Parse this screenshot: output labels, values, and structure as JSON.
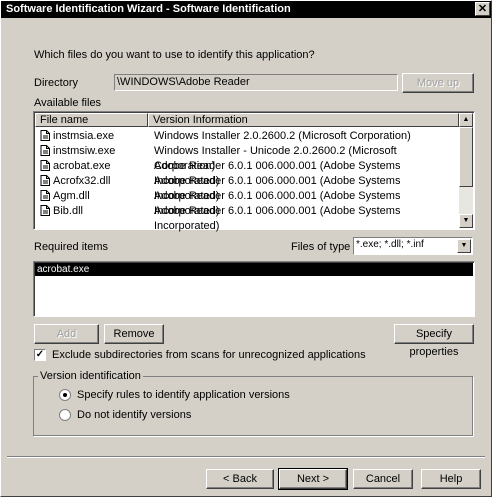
{
  "window": {
    "title": "Software Identification Wizard - Software Identification",
    "close_label": "✕"
  },
  "prompt": "Which files do you want to use to identify this application?",
  "directory": {
    "label": "Directory",
    "value": "\\WINDOWS\\Adobe Reader",
    "move_up_label": "Move up"
  },
  "available_files": {
    "label": "Available files",
    "columns": [
      "File name",
      "Version Information"
    ],
    "rows": [
      {
        "name": "instmsia.exe",
        "version": "Windows Installer 2.0.2600.2 (Microsoft Corporation)"
      },
      {
        "name": "instmsiw.exe",
        "version": "Windows Installer - Unicode 2.0.2600.2 (Microsoft Corporation)"
      },
      {
        "name": "acrobat.exe",
        "version": "Adobe Reader 6.0.1 006.000.001 (Adobe Systems Incorporated)"
      },
      {
        "name": "Acrofx32.dll",
        "version": "Adobe Reader 6.0.1 006.000.001 (Adobe Systems Incorporated)"
      },
      {
        "name": "Agm.dll",
        "version": "Adobe Reader 6.0.1 006.000.001 (Adobe Systems Incorporated)"
      },
      {
        "name": "Bib.dll",
        "version": "Adobe Reader 6.0.1 006.000.001 (Adobe Systems Incorporated)"
      }
    ]
  },
  "required_items": {
    "label": "Required items",
    "files_of_type_label": "Files of type",
    "files_of_type_value": "*.exe; *.dll; *.inf",
    "items": [
      "acrobat.exe"
    ],
    "selected_color": "#000000"
  },
  "actions": {
    "add_label": "Add",
    "remove_label": "Remove",
    "specify_properties_label": "Specify properties"
  },
  "exclude_subdirs": {
    "label": "Exclude subdirectories from scans for unrecognized applications",
    "checked": true,
    "check_glyph": "✓"
  },
  "version_identification": {
    "label": "Version identification",
    "options": [
      {
        "label": "Specify rules to identify application versions",
        "selected": true
      },
      {
        "label": "Do not identify versions",
        "selected": false
      }
    ]
  },
  "footer": {
    "back_label": "< Back",
    "next_label": "Next >",
    "cancel_label": "Cancel",
    "help_label": "Help"
  },
  "icons": {
    "scroll_up": "▲",
    "scroll_down": "▼",
    "dropdown": "▼",
    "file": "file-icon"
  }
}
